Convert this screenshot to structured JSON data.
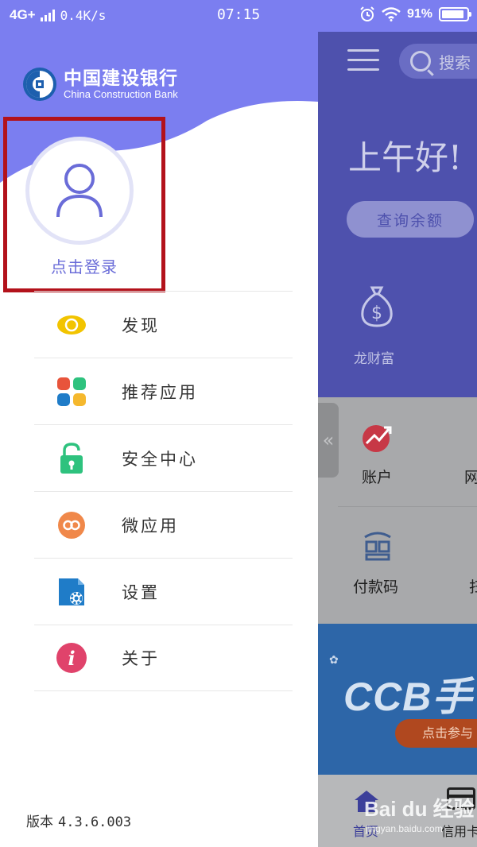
{
  "status_bar": {
    "network": "4G+",
    "speed": "0.4K/s",
    "time": "07:15",
    "battery": "91%",
    "battery_level": 0.91,
    "icons": [
      "signal-icon",
      "alarm-icon",
      "wifi-icon",
      "battery-icon"
    ]
  },
  "drawer": {
    "bank_name_cn": "中国建设银行",
    "bank_name_en": "China Construction Bank",
    "login_label": "点击登录",
    "menu": [
      {
        "label": "发现",
        "icon": "eye-icon",
        "color": "#f2c400"
      },
      {
        "label": "推荐应用",
        "icon": "apps-grid-icon",
        "color": "#e8543b"
      },
      {
        "label": "安全中心",
        "icon": "lock-icon",
        "color": "#2ec27e"
      },
      {
        "label": "微应用",
        "icon": "link-icon",
        "color": "#f0884a"
      },
      {
        "label": "设置",
        "icon": "gear-icon",
        "color": "#1f7cc8"
      },
      {
        "label": "关于",
        "icon": "info-icon",
        "color": "#e0436b"
      }
    ],
    "version_label": "版本",
    "version_number": "4.3.6.003"
  },
  "home": {
    "search_placeholder": "搜索",
    "greeting": "上午好!",
    "balance_button": "查询余额",
    "wealth_label": "龙财富",
    "collapse_glyph": "«",
    "account_label": "账户",
    "account_next": "网",
    "paycode_label": "付款码",
    "paycode_next": "扫",
    "banner_text": "CCB手",
    "banner_button": "点击参与",
    "tab_home": "首页",
    "tab_credit": "信用卡"
  },
  "watermark": {
    "text": "Bai du 经验",
    "url": "jingyan.baidu.com"
  },
  "colors": {
    "accent": "#7b7ef0",
    "login_highlight": "#b3121b",
    "login_text": "#6a6cd8",
    "home_header": "#4e51ad"
  }
}
